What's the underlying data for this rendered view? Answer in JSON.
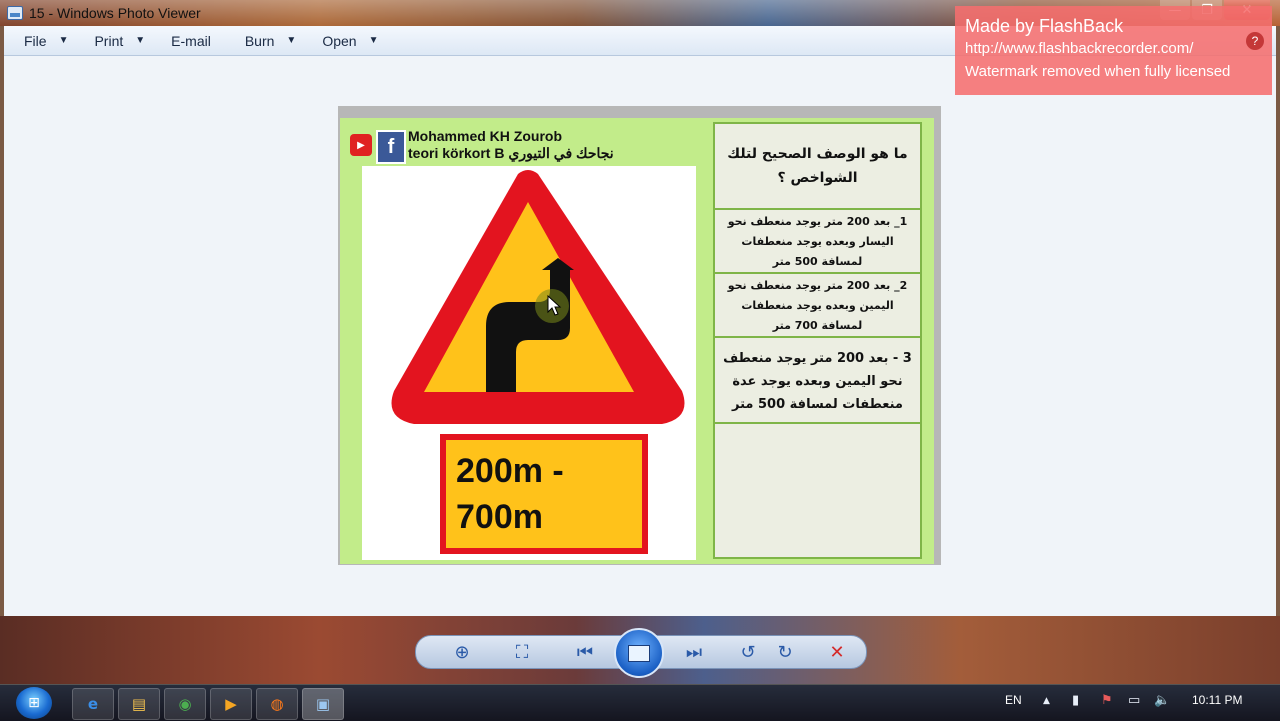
{
  "window": {
    "title": "15 - Windows Photo Viewer",
    "buttons": {
      "minimize": "—",
      "maximize": "❐",
      "close": "✕"
    }
  },
  "menu": [
    {
      "label": "File",
      "has_caret": true
    },
    {
      "label": "Print",
      "has_caret": true
    },
    {
      "label": "E-mail",
      "has_caret": false
    },
    {
      "label": "Burn",
      "has_caret": true
    },
    {
      "label": "Open",
      "has_caret": true
    }
  ],
  "photo": {
    "author_line1": "Mohammed KH Zourob",
    "author_line2": "teori körkort B نجاحك في التيوري",
    "question": "ما هو الوصف الصحيح لتلك الشواخص ؟",
    "options": [
      "1_  بعد 200 متر يوجد منعطف نحو اليسار وبعده يوجد منعطفات لمسافة 500 متر",
      "2_ بعد 200 متر يوجد منعطف نحو اليمين وبعده يوجد منعطفات لمسافة 700 متر",
      "3 -  بعد 200 متر يوجد منعطف نحو اليمين وبعده يوجد عدة منعطفات لمسافة 500 متر"
    ],
    "distance_line1": "200m -",
    "distance_line2": "700m"
  },
  "watermark": {
    "title": "Made by FlashBack",
    "url": "http://www.flashbackrecorder.com/",
    "note": "Watermark removed when fully licensed",
    "help": "?"
  },
  "taskbar": {
    "language": "EN",
    "time": "10:11 PM"
  },
  "icons": {
    "caret": "▼",
    "zoom": "⊕",
    "fit": "⛶",
    "prev": "⏮",
    "next": "⏭",
    "rotate_ccw": "↺",
    "rotate_cw": "↻",
    "delete": "✕",
    "start": "⊞",
    "ie": "e",
    "folder": "▤",
    "chrome": "◉",
    "media": "▶",
    "firefox": "◍",
    "photo_viewer": "▣",
    "tray_up": "▲",
    "signal": "▮",
    "flag": "⚑",
    "battery": "▭",
    "volume": "🔈"
  },
  "colors": {
    "sign_red": "#e3141f",
    "sign_yellow": "#ffc21a",
    "panel_green": "#c2ec8a"
  }
}
